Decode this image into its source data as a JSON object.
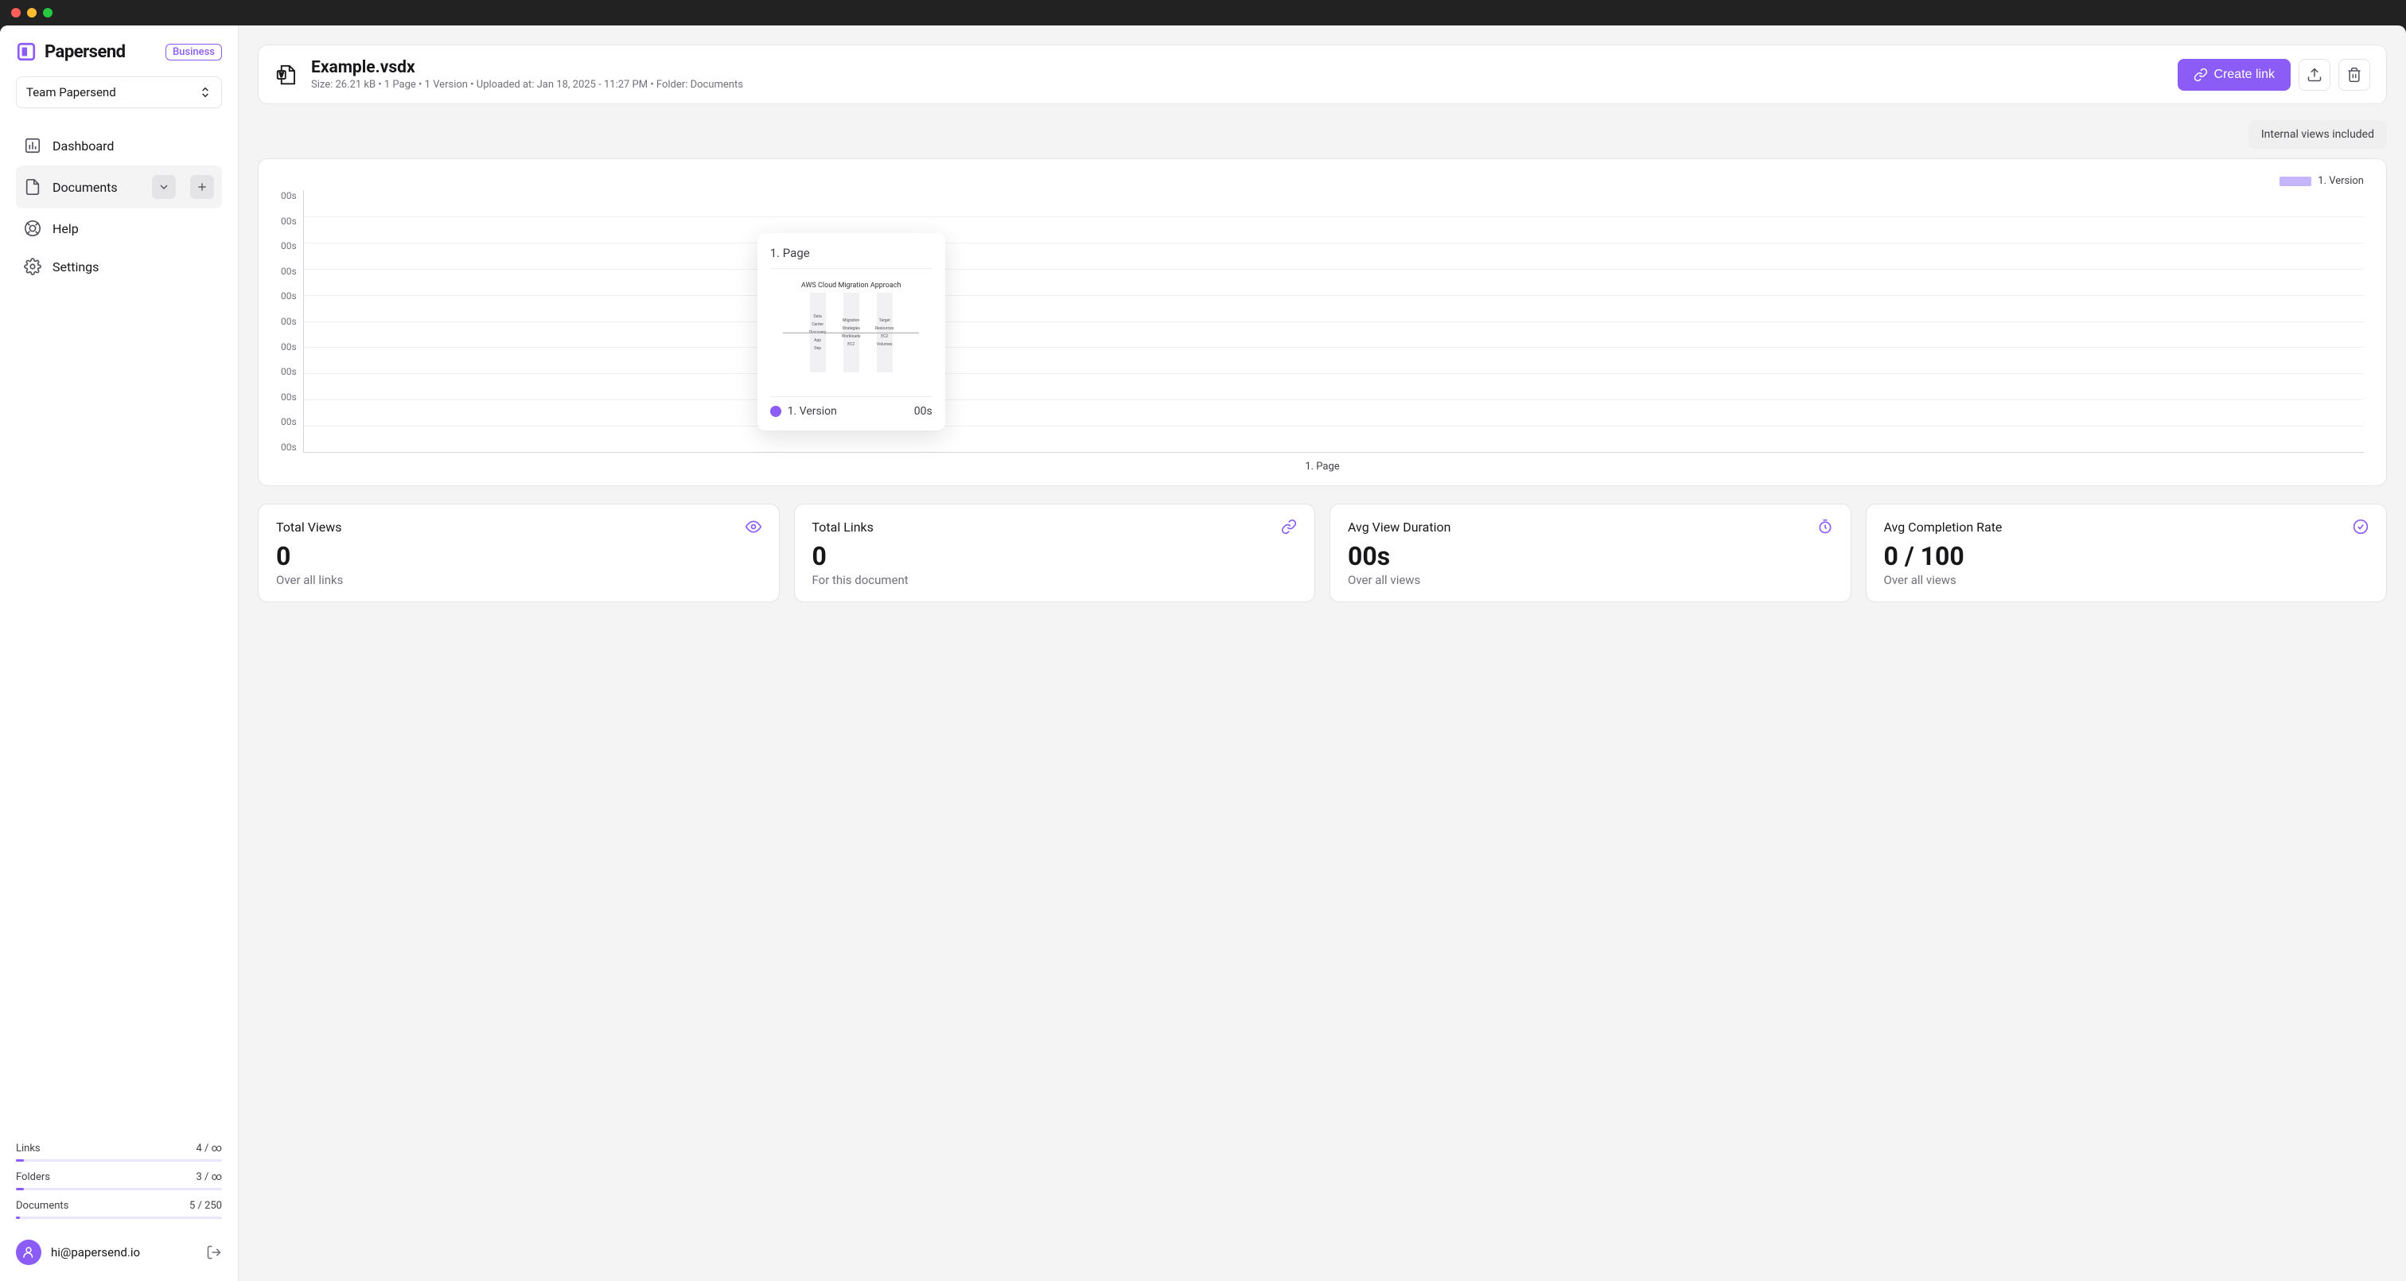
{
  "brand": {
    "name": "Papersend",
    "tier": "Business"
  },
  "team": {
    "selected": "Team Papersend"
  },
  "nav": {
    "dashboard": "Dashboard",
    "documents": "Documents",
    "help": "Help",
    "settings": "Settings"
  },
  "usage": {
    "links": {
      "label": "Links",
      "value": "4 / ∞",
      "fill": 4
    },
    "folders": {
      "label": "Folders",
      "value": "3 / ∞",
      "fill": 4
    },
    "documents": {
      "label": "Documents",
      "value": "5 / 250",
      "fill": 2
    }
  },
  "user": {
    "email": "hi@papersend.io"
  },
  "file": {
    "name": "Example.vsdx",
    "meta": "Size: 26.21 kB • 1 Page • 1 Version • Uploaded at: Jan 18, 2025 - 11:27 PM • Folder: Documents"
  },
  "actions": {
    "create_link": "Create link"
  },
  "toggle": {
    "internal_views": "Internal views included"
  },
  "chart_data": {
    "type": "bar",
    "categories": [
      "1. Page"
    ],
    "series": [
      {
        "name": "1. Version",
        "values": [
          0
        ]
      }
    ],
    "y_ticks": [
      "00s",
      "00s",
      "00s",
      "00s",
      "00s",
      "00s",
      "00s",
      "00s",
      "00s",
      "00s",
      "00s"
    ],
    "xlabel": "1. Page",
    "legend": "1. Version",
    "tooltip": {
      "title": "1. Page",
      "thumb_title": "AWS Cloud Migration Approach",
      "series_name": "1. Version",
      "series_value": "00s"
    }
  },
  "stats": {
    "views": {
      "title": "Total Views",
      "value": "0",
      "sub": "Over all links"
    },
    "links": {
      "title": "Total Links",
      "value": "0",
      "sub": "For this document"
    },
    "duration": {
      "title": "Avg View Duration",
      "value": "00s",
      "sub": "Over all views"
    },
    "completion": {
      "title": "Avg Completion Rate",
      "value": "0 / 100",
      "sub": "Over all views"
    }
  }
}
